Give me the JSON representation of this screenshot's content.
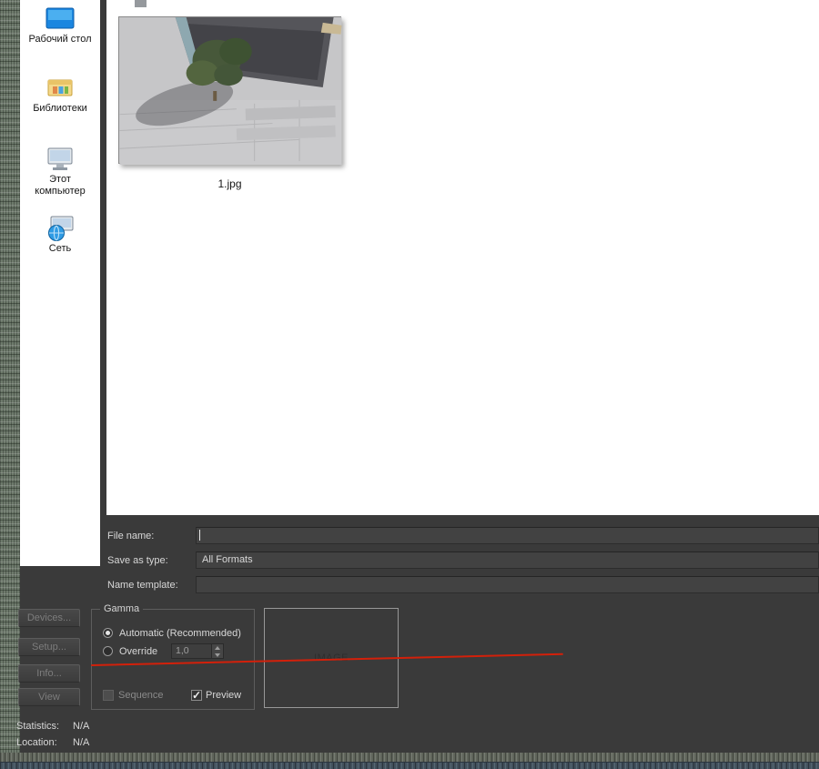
{
  "window": {
    "background": "#3a3a3a",
    "annotation_color": "#d3200a"
  },
  "sidebar": {
    "items": [
      {
        "label": "Рабочий стол"
      },
      {
        "label": "Библиотеки"
      },
      {
        "label": "Этот компьютер"
      },
      {
        "label": "Сеть"
      }
    ]
  },
  "file_list": {
    "items": [
      {
        "name": "1.jpg"
      }
    ]
  },
  "form": {
    "file_name": {
      "label": "File name:",
      "value": ""
    },
    "save_as_type": {
      "label": "Save as type:",
      "value": "All Formats"
    },
    "name_template": {
      "label": "Name template:",
      "value": ""
    }
  },
  "gamma": {
    "title": "Gamma",
    "automatic_label": "Automatic (Recommended)",
    "automatic_selected": true,
    "override_label": "Override",
    "override_selected": false,
    "override_value": "1,0"
  },
  "preview_box": {
    "label": "IMAGE"
  },
  "options": {
    "sequence": {
      "label": "Sequence",
      "checked": false,
      "enabled": false
    },
    "preview": {
      "label": "Preview",
      "checked": true,
      "enabled": true
    }
  },
  "side_buttons": [
    {
      "label": "Devices...",
      "enabled": false
    },
    {
      "label": "Setup...",
      "enabled": false
    },
    {
      "label": "Info...",
      "enabled": false
    },
    {
      "label": "View",
      "enabled": false
    }
  ],
  "status": {
    "statistics_label": "Statistics:",
    "statistics_value": "N/A",
    "location_label": "Location:",
    "location_value": "N/A"
  }
}
